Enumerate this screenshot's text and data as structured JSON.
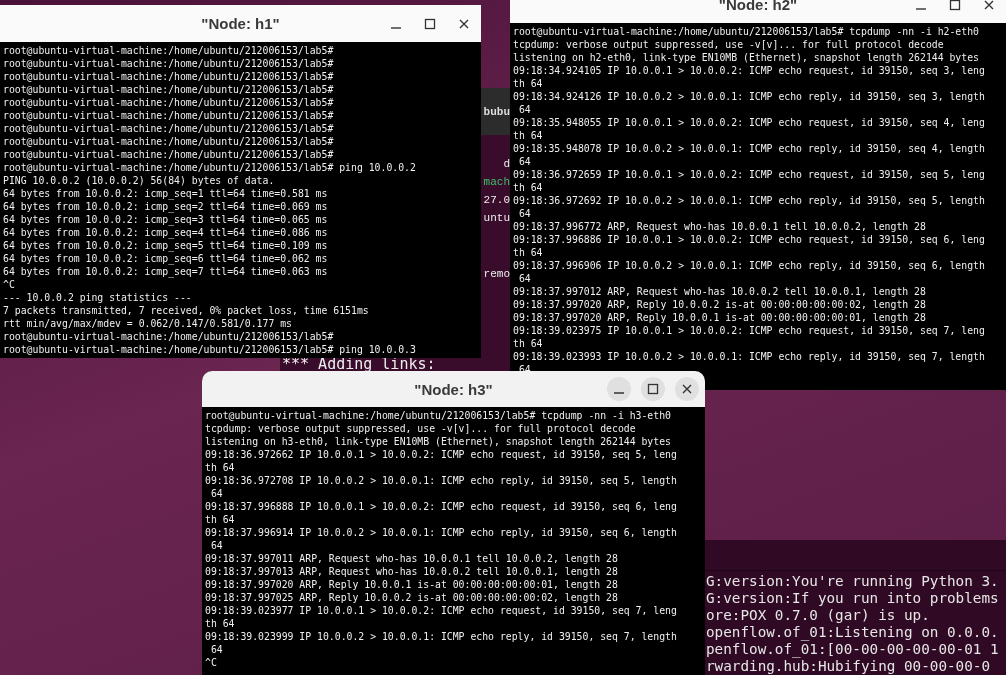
{
  "background_terminal": {
    "tab_fragment": "bubu",
    "lines": [
      {
        "text": "d",
        "kind": "plain"
      },
      {
        "text": "mach",
        "kind": "highlight"
      },
      {
        "text": "27.0",
        "kind": "plain"
      },
      {
        "text": "untu",
        "kind": "plain"
      },
      {
        "text": "remo",
        "kind": "plain"
      }
    ],
    "bottom_line": "*** Adding links:"
  },
  "pox_terminal": {
    "lines": [
      "G:version:You're running Python 3.",
      "G:version:If you run into problems",
      "ore:POX 0.7.0 (gar) is up.",
      "openflow.of_01:Listening on 0.0.0.",
      "penflow.of_01:[00-00-00-00-00-01 1",
      "rwarding.hub:Hubifying 00-00-00-0"
    ]
  },
  "windows": [
    {
      "title": "\"Node: h1\"",
      "kind": "plain",
      "lines": [
        "root@ubuntu-virtual-machine:/home/ubuntu/212006153/lab5#",
        "root@ubuntu-virtual-machine:/home/ubuntu/212006153/lab5#",
        "root@ubuntu-virtual-machine:/home/ubuntu/212006153/lab5#",
        "root@ubuntu-virtual-machine:/home/ubuntu/212006153/lab5#",
        "root@ubuntu-virtual-machine:/home/ubuntu/212006153/lab5#",
        "root@ubuntu-virtual-machine:/home/ubuntu/212006153/lab5#",
        "root@ubuntu-virtual-machine:/home/ubuntu/212006153/lab5#",
        "root@ubuntu-virtual-machine:/home/ubuntu/212006153/lab5#",
        "root@ubuntu-virtual-machine:/home/ubuntu/212006153/lab5#",
        "root@ubuntu-virtual-machine:/home/ubuntu/212006153/lab5# ping 10.0.0.2",
        "PING 10.0.0.2 (10.0.0.2) 56(84) bytes of data.",
        "64 bytes from 10.0.0.2: icmp_seq=1 ttl=64 time=0.581 ms",
        "64 bytes from 10.0.0.2: icmp_seq=2 ttl=64 time=0.069 ms",
        "64 bytes from 10.0.0.2: icmp_seq=3 ttl=64 time=0.065 ms",
        "64 bytes from 10.0.0.2: icmp_seq=4 ttl=64 time=0.086 ms",
        "64 bytes from 10.0.0.2: icmp_seq=5 ttl=64 time=0.109 ms",
        "64 bytes from 10.0.0.2: icmp_seq=6 ttl=64 time=0.062 ms",
        "64 bytes from 10.0.0.2: icmp_seq=7 ttl=64 time=0.063 ms",
        "^C",
        "--- 10.0.0.2 ping statistics ---",
        "7 packets transmitted, 7 received, 0% packet loss, time 6151ms",
        "rtt min/avg/max/mdev = 0.062/0.147/0.581/0.177 ms",
        "root@ubuntu-virtual-machine:/home/ubuntu/212006153/lab5#",
        "root@ubuntu-virtual-machine:/home/ubuntu/212006153/lab5# ping 10.0.0.3"
      ]
    },
    {
      "title": "\"Node: h2\"",
      "kind": "plain",
      "lines": [
        "root@ubuntu-virtual-machine:/home/ubuntu/212006153/lab5# tcpdump -nn -i h2-eth0",
        "tcpdump: verbose output suppressed, use -v[v]... for full protocol decode",
        "listening on h2-eth0, link-type EN10MB (Ethernet), snapshot length 262144 bytes",
        "09:18:34.924105 IP 10.0.0.1 > 10.0.0.2: ICMP echo request, id 39150, seq 3, leng",
        "th 64",
        "09:18:34.924126 IP 10.0.0.2 > 10.0.0.1: ICMP echo reply, id 39150, seq 3, length",
        " 64",
        "09:18:35.948055 IP 10.0.0.1 > 10.0.0.2: ICMP echo request, id 39150, seq 4, leng",
        "th 64",
        "09:18:35.948078 IP 10.0.0.2 > 10.0.0.1: ICMP echo reply, id 39150, seq 4, length",
        " 64",
        "09:18:36.972659 IP 10.0.0.1 > 10.0.0.2: ICMP echo request, id 39150, seq 5, leng",
        "th 64",
        "09:18:36.972692 IP 10.0.0.2 > 10.0.0.1: ICMP echo reply, id 39150, seq 5, length",
        " 64",
        "09:18:37.996772 ARP, Request who-has 10.0.0.1 tell 10.0.0.2, length 28",
        "09:18:37.996886 IP 10.0.0.1 > 10.0.0.2: ICMP echo request, id 39150, seq 6, leng",
        "th 64",
        "09:18:37.996906 IP 10.0.0.2 > 10.0.0.1: ICMP echo reply, id 39150, seq 6, length",
        " 64",
        "09:18:37.997012 ARP, Request who-has 10.0.0.2 tell 10.0.0.1, length 28",
        "09:18:37.997020 ARP, Reply 10.0.0.2 is-at 00:00:00:00:00:02, length 28",
        "09:18:37.997020 ARP, Reply 10.0.0.1 is-at 00:00:00:00:00:01, length 28",
        "09:18:39.023975 IP 10.0.0.1 > 10.0.0.2: ICMP echo request, id 39150, seq 7, leng",
        "th 64",
        "09:18:39.023993 IP 10.0.0.2 > 10.0.0.1: ICMP echo reply, id 39150, seq 7, length",
        " 64"
      ]
    },
    {
      "title": "\"Node: h3\"",
      "kind": "round",
      "lines": [
        "root@ubuntu-virtual-machine:/home/ubuntu/212006153/lab5# tcpdump -nn -i h3-eth0",
        "tcpdump: verbose output suppressed, use -v[v]... for full protocol decode",
        "listening on h3-eth0, link-type EN10MB (Ethernet), snapshot length 262144 bytes",
        "09:18:36.972662 IP 10.0.0.1 > 10.0.0.2: ICMP echo request, id 39150, seq 5, leng",
        "th 64",
        "09:18:36.972708 IP 10.0.0.2 > 10.0.0.1: ICMP echo reply, id 39150, seq 5, length",
        " 64",
        "09:18:37.996888 IP 10.0.0.1 > 10.0.0.2: ICMP echo request, id 39150, seq 6, leng",
        "th 64",
        "09:18:37.996914 IP 10.0.0.2 > 10.0.0.1: ICMP echo reply, id 39150, seq 6, length",
        " 64",
        "09:18:37.997011 ARP, Request who-has 10.0.0.1 tell 10.0.0.2, length 28",
        "09:18:37.997013 ARP, Request who-has 10.0.0.2 tell 10.0.0.1, length 28",
        "09:18:37.997020 ARP, Reply 10.0.0.1 is-at 00:00:00:00:00:01, length 28",
        "09:18:37.997025 ARP, Reply 10.0.0.2 is-at 00:00:00:00:00:02, length 28",
        "09:18:39.023977 IP 10.0.0.1 > 10.0.0.2: ICMP echo request, id 39150, seq 7, leng",
        "th 64",
        "09:18:39.023999 IP 10.0.0.2 > 10.0.0.1: ICMP echo reply, id 39150, seq 7, length",
        " 64",
        "^C"
      ]
    }
  ]
}
